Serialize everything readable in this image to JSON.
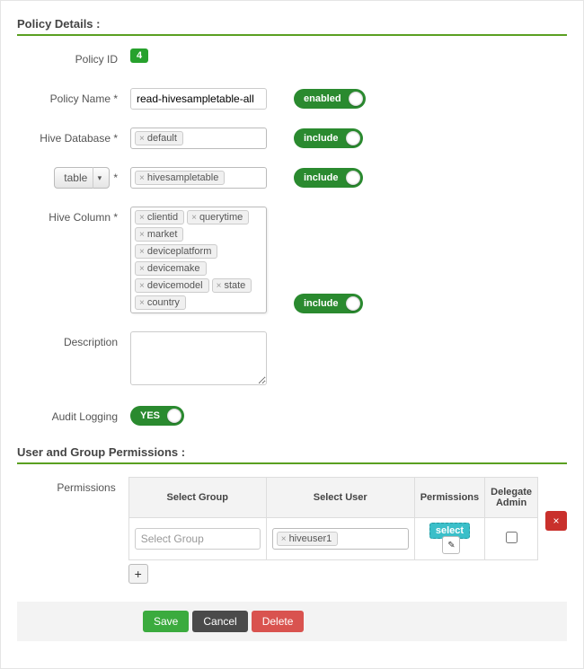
{
  "headers": {
    "policy_details": "Policy Details :",
    "user_group_perms": "User and Group Permissions :"
  },
  "labels": {
    "policy_id": "Policy ID",
    "policy_name": "Policy Name *",
    "hive_database": "Hive Database *",
    "table_select": "table",
    "hive_column": "Hive Column *",
    "description": "Description",
    "audit_logging": "Audit Logging",
    "permissions": "Permissions",
    "asterisk_only": "*"
  },
  "values": {
    "policy_id": "4",
    "policy_name": "read-hivesampletable-all",
    "hive_database_tags": [
      "default"
    ],
    "table_tags": [
      "hivesampletable"
    ],
    "hive_column_tags": [
      "clientid",
      "querytime",
      "market",
      "deviceplatform",
      "devicemake",
      "devicemodel",
      "state",
      "country"
    ],
    "description": ""
  },
  "toggles": {
    "enabled": "enabled",
    "include1": "include",
    "include2": "include",
    "include3": "include",
    "audit_yes": "YES"
  },
  "perm_table": {
    "headers": {
      "select_group": "Select Group",
      "select_user": "Select User",
      "permissions": "Permissions",
      "delegate_admin": "Delegate Admin"
    },
    "row": {
      "group_placeholder": "Select Group",
      "user_tags": [
        "hiveuser1"
      ],
      "perm_chip": "select",
      "delegate_checked": false
    }
  },
  "buttons": {
    "save": "Save",
    "cancel": "Cancel",
    "delete": "Delete",
    "add": "+",
    "row_delete": "×",
    "edit": "✎",
    "tag_x": "×"
  }
}
